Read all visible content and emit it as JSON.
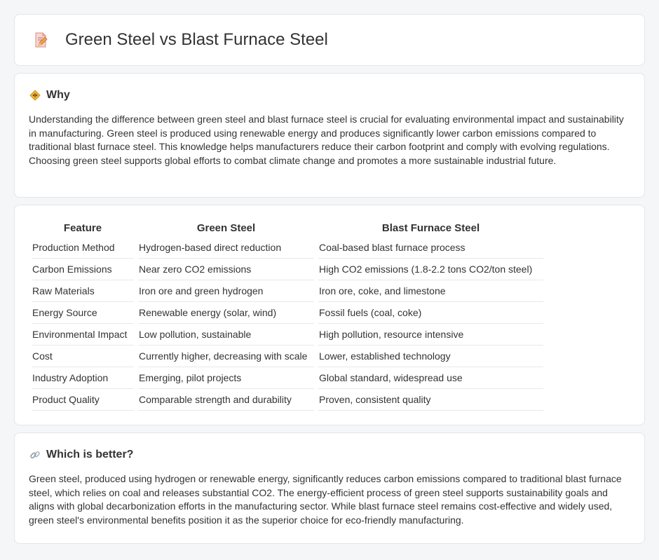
{
  "header": {
    "title": "Green Steel vs Blast Furnace Steel",
    "icon": "pencil-doc-icon"
  },
  "why": {
    "title": "Why",
    "icon": "warning-sign-icon",
    "text": "Understanding the difference between green steel and blast furnace steel is crucial for evaluating environmental impact and sustainability in manufacturing. Green steel is produced using renewable energy and produces significantly lower carbon emissions compared to traditional blast furnace steel. This knowledge helps manufacturers reduce their carbon footprint and comply with evolving regulations. Choosing green steel supports global efforts to combat climate change and promotes a more sustainable industrial future."
  },
  "comparison": {
    "headers": [
      "Feature",
      "Green Steel",
      "Blast Furnace Steel"
    ],
    "rows": [
      [
        "Production Method",
        "Hydrogen-based direct reduction",
        "Coal-based blast furnace process"
      ],
      [
        "Carbon Emissions",
        "Near zero CO2 emissions",
        "High CO2 emissions (1.8-2.2 tons CO2/ton steel)"
      ],
      [
        "Raw Materials",
        "Iron ore and green hydrogen",
        "Iron ore, coke, and limestone"
      ],
      [
        "Energy Source",
        "Renewable energy (solar, wind)",
        "Fossil fuels (coal, coke)"
      ],
      [
        "Environmental Impact",
        "Low pollution, sustainable",
        "High pollution, resource intensive"
      ],
      [
        "Cost",
        "Currently higher, decreasing with scale",
        "Lower, established technology"
      ],
      [
        "Industry Adoption",
        "Emerging, pilot projects",
        "Global standard, widespread use"
      ],
      [
        "Product Quality",
        "Comparable strength and durability",
        "Proven, consistent quality"
      ]
    ]
  },
  "better": {
    "title": "Which is better?",
    "icon": "link-icon",
    "text": "Green steel, produced using hydrogen or renewable energy, significantly reduces carbon emissions compared to traditional blast furnace steel, which relies on coal and releases substantial CO2. The energy-efficient process of green steel supports sustainability goals and aligns with global decarbonization efforts in the manufacturing sector. While blast furnace steel remains cost-effective and widely used, green steel's environmental benefits position it as the superior choice for eco-friendly manufacturing."
  }
}
